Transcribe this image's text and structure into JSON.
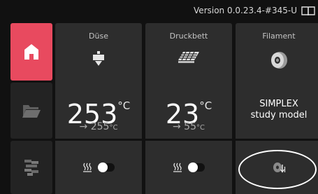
{
  "status": {
    "version": "Version 0.0.23.4-#345-U",
    "manual_icon": "book-icon"
  },
  "nav": {
    "items": [
      {
        "name": "home",
        "icon": "home-icon",
        "active": true
      },
      {
        "name": "files",
        "icon": "folder-icon",
        "active": false
      },
      {
        "name": "tools",
        "icon": "tools-icon",
        "active": false
      }
    ],
    "accent_color": "#e84a5f"
  },
  "nozzle": {
    "title": "Düse",
    "icon": "nozzle-icon",
    "current": "253",
    "unit": "°C",
    "target": "→ 255",
    "target_unit": "°C",
    "heater_icon": "heater-icon",
    "heater_on": false
  },
  "bed": {
    "title": "Druckbett",
    "icon": "heatbed-icon",
    "current": "23",
    "unit": "°C",
    "target": "→ 55",
    "target_unit": "°C",
    "heater_icon": "heater-icon",
    "heater_on": false
  },
  "filament": {
    "title": "Filament",
    "icon": "spool-icon",
    "name_line1": "SIMPLEX",
    "name_line2": "study model",
    "action_icon": "unload-filament-icon"
  }
}
